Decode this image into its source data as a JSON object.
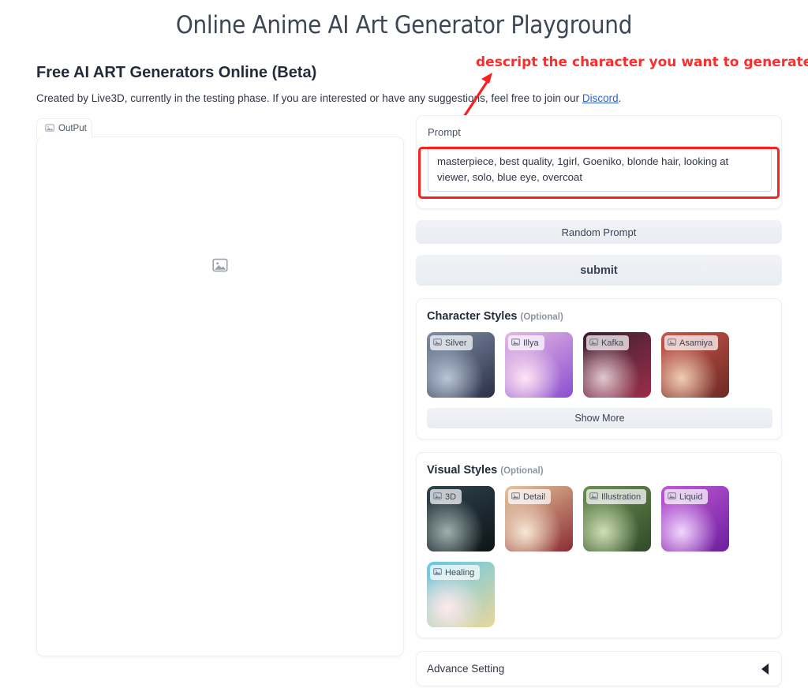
{
  "header": {
    "title": "Online Anime AI Art Generator Playground",
    "subtitle": "Free AI ART Generators Online (Beta)",
    "description_before": "Created by Live3D, currently in the testing phase. If you are interested or have any suggestions, feel free to join our ",
    "description_link": "Discord",
    "description_after": "."
  },
  "annotation": {
    "text": "descript the character you want to generate",
    "color": "#fb2d2d",
    "box_color": "#fb1f20"
  },
  "output": {
    "tab_label": "OutPut",
    "tab_icon": "image-placeholder-icon",
    "placeholder_icon": "image-placeholder-icon"
  },
  "prompt": {
    "label": "Prompt",
    "value": "masterpiece, best quality, 1girl, Goeniko, blonde hair, looking at viewer, solo, blue eye, overcoat",
    "placeholder": "Prompt",
    "random_label": "Random Prompt",
    "submit_label": "submit"
  },
  "character_styles": {
    "title": "Character Styles",
    "optional": "(Optional)",
    "show_more_label": "Show More",
    "items": [
      {
        "label": "Silver",
        "icon": "image-placeholder-icon",
        "c1": "#7e8fa8",
        "c2": "#2b2f46",
        "c3": "#b9c6d8"
      },
      {
        "label": "Illya",
        "icon": "image-placeholder-icon",
        "c1": "#e6b9e4",
        "c2": "#8a4fd0",
        "c3": "#ffe6f4"
      },
      {
        "label": "Kafka",
        "icon": "image-placeholder-icon",
        "c1": "#3a2030",
        "c2": "#9d2d4a",
        "c3": "#e0c8cf"
      },
      {
        "label": "Asamiya",
        "icon": "image-placeholder-icon",
        "c1": "#c9564a",
        "c2": "#6d2a24",
        "c3": "#f0cdb4"
      }
    ]
  },
  "visual_styles": {
    "title": "Visual Styles",
    "optional": "(Optional)",
    "items": [
      {
        "label": "3D",
        "icon": "image-placeholder-icon",
        "c1": "#2f4450",
        "c2": "#0e1417",
        "c3": "#9fb0ad"
      },
      {
        "label": "Detail",
        "icon": "image-placeholder-icon",
        "c1": "#e7c79c",
        "c2": "#8c2b33",
        "c3": "#f7e8d4"
      },
      {
        "label": "Illustration",
        "icon": "image-placeholder-icon",
        "c1": "#6c8f4e",
        "c2": "#2f4a2a",
        "c3": "#cfe0b6"
      },
      {
        "label": "Liquid",
        "icon": "image-placeholder-icon",
        "c1": "#c058d8",
        "c2": "#6c1f9e",
        "c3": "#f3d6ff"
      },
      {
        "label": "Healing",
        "icon": "image-placeholder-icon",
        "c1": "#63c8e8",
        "c2": "#e9d79a",
        "c3": "#ffeaf0"
      }
    ]
  },
  "advance_setting": {
    "label": "Advance Setting",
    "chevron_icon": "triangle-left-icon"
  }
}
